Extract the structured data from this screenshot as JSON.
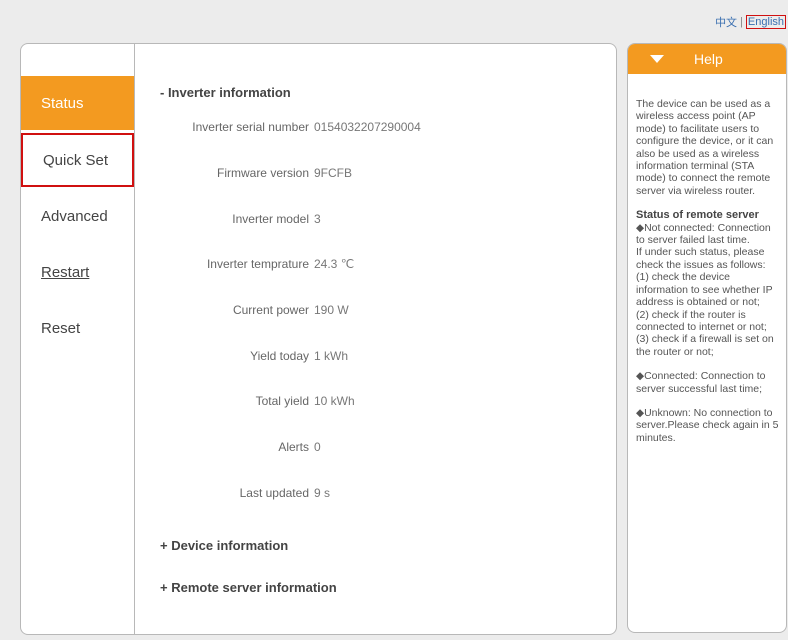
{
  "lang": {
    "zh": "中文",
    "separator": "|",
    "en": "English"
  },
  "nav": {
    "items": [
      {
        "label": "Status"
      },
      {
        "label": "Quick Set"
      },
      {
        "label": "Advanced"
      },
      {
        "label": "Restart"
      },
      {
        "label": "Reset"
      }
    ]
  },
  "sections": {
    "inverter": {
      "title": "- Inverter information"
    },
    "device": {
      "title": "+ Device information"
    },
    "remote": {
      "title": "+ Remote server information"
    }
  },
  "inverter_rows": [
    {
      "label": "Inverter serial number",
      "value": "0154032207290004"
    },
    {
      "label": "Firmware version",
      "value": "9FCFB"
    },
    {
      "label": "Inverter model",
      "value": "3"
    },
    {
      "label": "Inverter temprature",
      "value": "24.3 ℃"
    },
    {
      "label": "Current power",
      "value": "190 W"
    },
    {
      "label": "Yield today",
      "value": "1 kWh"
    },
    {
      "label": "Total yield",
      "value": "10 kWh"
    },
    {
      "label": "Alerts",
      "value": "0"
    },
    {
      "label": "Last updated",
      "value": "9 s"
    }
  ],
  "help": {
    "title": "Help",
    "intro": "The device can be used as a wireless access point (AP mode) to facilitate users to configure the device, or it can also be used as a wireless information terminal (STA mode) to connect the remote server via wireless router.",
    "status_title": "Status of remote server",
    "not_connected": "◆Not connected: Connection to server failed last time.",
    "check_intro": "If under such status, please check the issues as follows:",
    "check1": "(1) check the device information to see whether IP address is obtained or not;",
    "check2": "(2) check if the router is connected to internet or not;",
    "check3": "(3) check if a firewall is set on the router or not;",
    "connected": "◆Connected: Connection to server successful last time;",
    "unknown": "◆Unknown: No connection to server.Please check again in 5 minutes."
  },
  "colors": {
    "accent": "#f39a20",
    "highlight": "#d01010"
  }
}
